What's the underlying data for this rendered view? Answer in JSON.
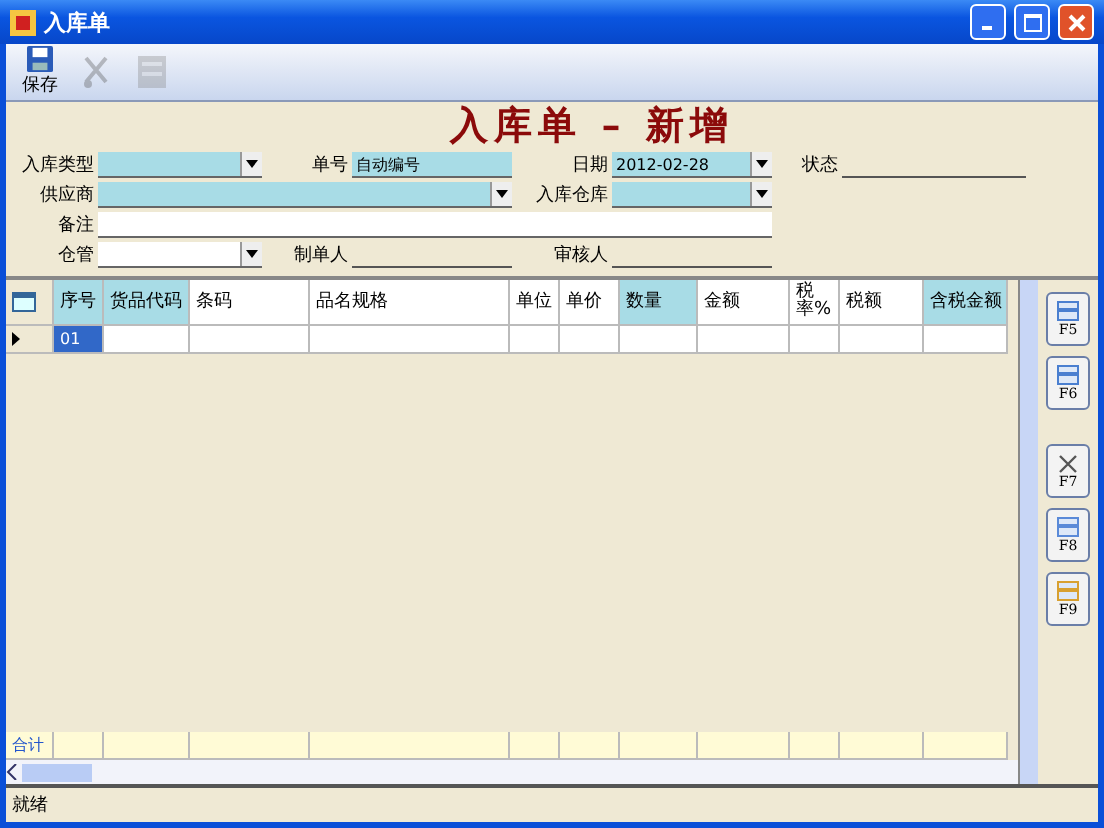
{
  "window": {
    "title": "入库单"
  },
  "toolbar": [
    {
      "kind": "save",
      "label": "保存",
      "disabled": false
    },
    {
      "kind": "cut",
      "disabled": true
    },
    {
      "kind": "form",
      "disabled": true
    }
  ],
  "heading": "入库单 – 新增",
  "form_rows": [
    [
      {
        "label": "入库类型",
        "kind": "combo",
        "highlighted": true
      },
      {
        "label": "单号",
        "kind": "text",
        "value": "自动编号",
        "highlighted": true
      },
      {
        "label": "日期",
        "kind": "combo",
        "value": "2012-02-28",
        "highlighted": true
      },
      {
        "label": "状态",
        "kind": "line"
      }
    ],
    [
      {
        "label": "供应商",
        "kind": "combo",
        "highlighted": true
      },
      {
        "label": "入库仓库",
        "kind": "combo",
        "highlighted": true
      }
    ],
    [
      {
        "label": "备注",
        "kind": "text",
        "highlighted": false
      }
    ],
    [
      {
        "label": "仓管",
        "kind": "combo",
        "highlighted": false
      },
      {
        "label": "制单人",
        "kind": "line"
      },
      {
        "label": "审核人",
        "kind": "line"
      }
    ]
  ],
  "grid": {
    "columns": [
      {
        "label": "序号",
        "highlighted": true
      },
      {
        "label": "货品代码",
        "highlighted": true
      },
      {
        "label": "条码",
        "highlighted": false
      },
      {
        "label": "品名规格",
        "highlighted": false
      },
      {
        "label": "单位",
        "highlighted": false
      },
      {
        "label": "单价",
        "highlighted": false
      },
      {
        "label": "数量",
        "highlighted": true
      },
      {
        "label": "金额",
        "highlighted": false
      },
      {
        "label": "税率%",
        "highlighted": false
      },
      {
        "label": "税额",
        "highlighted": false
      },
      {
        "label": "含税金额",
        "highlighted": true
      }
    ],
    "rows": [
      {
        "number": "01",
        "selected": true
      }
    ],
    "footer": "合计"
  },
  "side_buttons": [
    {
      "key": "F5",
      "kind": "add"
    },
    {
      "key": "F6",
      "kind": "insert"
    },
    {
      "key": "F7",
      "kind": "delete"
    },
    {
      "key": "F8",
      "kind": "copy"
    },
    {
      "key": "F9",
      "kind": "paste"
    }
  ],
  "status_bar": "就绪"
}
